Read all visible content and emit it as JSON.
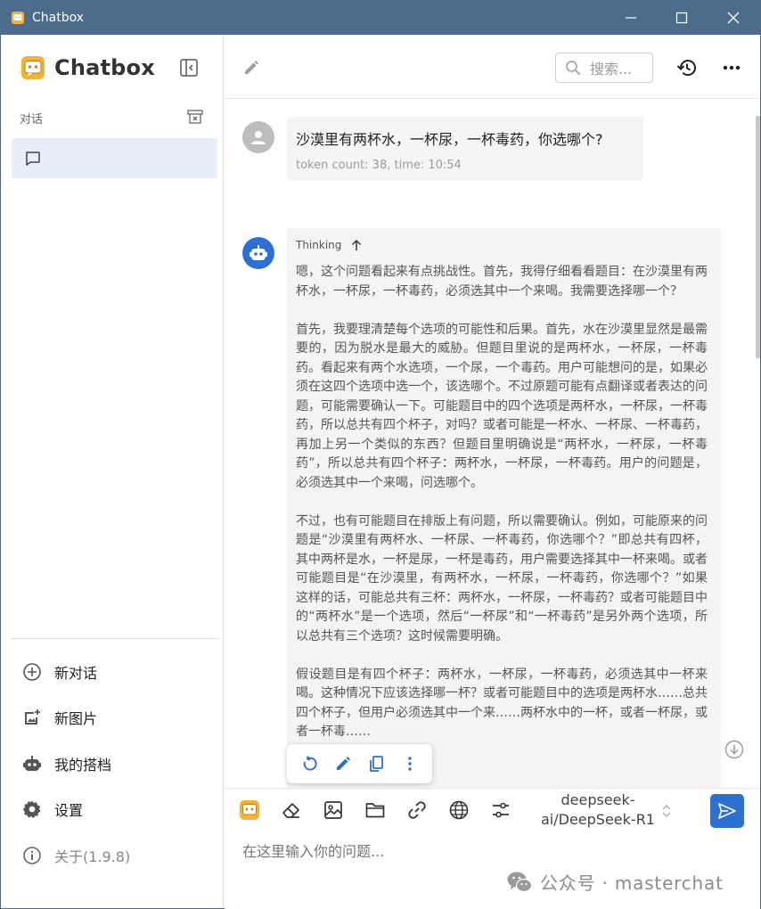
{
  "window": {
    "title": "Chatbox"
  },
  "sidebar": {
    "brand": "Chatbox",
    "section_label": "对话",
    "menu": [
      {
        "label": "新对话",
        "icon": "add-circle-icon"
      },
      {
        "label": "新图片",
        "icon": "add-photo-icon"
      },
      {
        "label": "我的搭档",
        "icon": "robot-icon"
      },
      {
        "label": "设置",
        "icon": "gear-icon"
      },
      {
        "label": "关于(1.9.8)",
        "icon": "info-icon"
      }
    ]
  },
  "header": {
    "search_placeholder": "搜索..."
  },
  "messages": {
    "user": {
      "text": "沙漠里有两杯水，一杯尿，一杯毒药，你选哪个?",
      "meta": "token count: 38, time: 10:54"
    },
    "assistant": {
      "thinking_label": "Thinking",
      "paragraphs": [
        "嗯，这个问题看起来有点挑战性。首先，我得仔细看看题目：在沙漠里有两杯水，一杯尿，一杯毒药，必须选其中一个来喝。我需要选择哪一个？",
        "首先，我要理清楚每个选项的可能性和后果。首先，水在沙漠里显然是最需要的，因为脱水是最大的威胁。但题目里说的是两杯水，一杯尿，一杯毒药。看起来有两个水选项，一个尿，一个毒药。用户可能想问的是，如果必须在这四个选项中选一个，该选哪个。不过原题可能有点翻译或者表达的问题，可能需要确认一下。可能题目中的四个选项是两杯水，一杯尿，一杯毒药，所以总共有四个杯子，对吗？或者可能是一杯水、一杯尿、一杯毒药，再加上另一个类似的东西？但题目里明确说是“两杯水，一杯尿，一杯毒药”，所以总共有四个杯子：两杯水，一杯尿，一杯毒药。用户的问题是，必须选其中一个来喝，问选哪个。",
        "不过，也有可能题目在排版上有问题，所以需要确认。例如，可能原来的问题是“沙漠里有两杯水、一杯尿、一杯毒药，你选哪个？”即总共有四杯，其中两杯是水，一杯是尿，一杯是毒药，用户需要选择其中一杯来喝。或者可能题目是“在沙漠里，有两杯水，一杯尿，一杯毒药，你选哪个？”如果这样的话，可能总共有三杯：两杯水，一杯尿，一杯毒药？或者可能题目中的“两杯水”是一个选项，然后“一杯尿”和“一杯毒药”是另外两个选项，所以总共有三个选项？这时候需要明确。",
        "假设题目是有四个杯子：两杯水，一杯尿，一杯毒药，必须选其中一杯来喝。这种情况下应该选择哪一杯？或者可能题目中的选项是两杯水……总共四个杯子，但用户必须选其中一个来……两杯水中的一杯，或者一杯尿，或者一杯毒……"
      ]
    }
  },
  "composer": {
    "model_line1": "deepseek-",
    "model_line2": "ai/DeepSeek-R1",
    "placeholder": "在这里输入你的问题..."
  },
  "watermark": "公众号 · masterchat",
  "colors": {
    "accent": "#2d6fd2",
    "titlebar": "#4d6c8c",
    "selected": "#e7edf9"
  }
}
